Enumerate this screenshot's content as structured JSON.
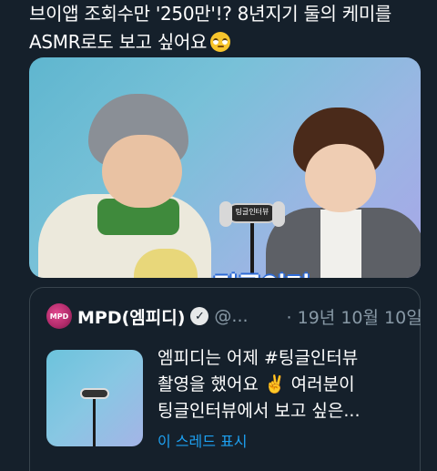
{
  "tweet": {
    "line1": "브이앱 조회수만 '250만'!? 8년지기 둘의 케미를",
    "line2": "ASMR로도 보고 싶어요",
    "emoji": "face-with-rolling-eyes"
  },
  "media": {
    "stand_sign": "팅글인터뷰",
    "caption": "팅글인터뷰"
  },
  "quoted": {
    "avatar_text": "MPD",
    "author": "MPD(엠피디)",
    "verified_icon": "verified-badge-icon",
    "handle": "@...",
    "date": "· 19년 10월 10일",
    "text_line1": "엠피디는 어제 #팅글인터뷰",
    "text_line2": "촬영을 했어요 ✌️ 여러분이",
    "text_line3": "팅글인터뷰에서 보고 싶은...",
    "show_thread": "이 스레드 표시"
  },
  "colors": {
    "background": "#15202b",
    "link": "#1da1f2",
    "muted": "#8899a6",
    "border": "#38444d"
  }
}
